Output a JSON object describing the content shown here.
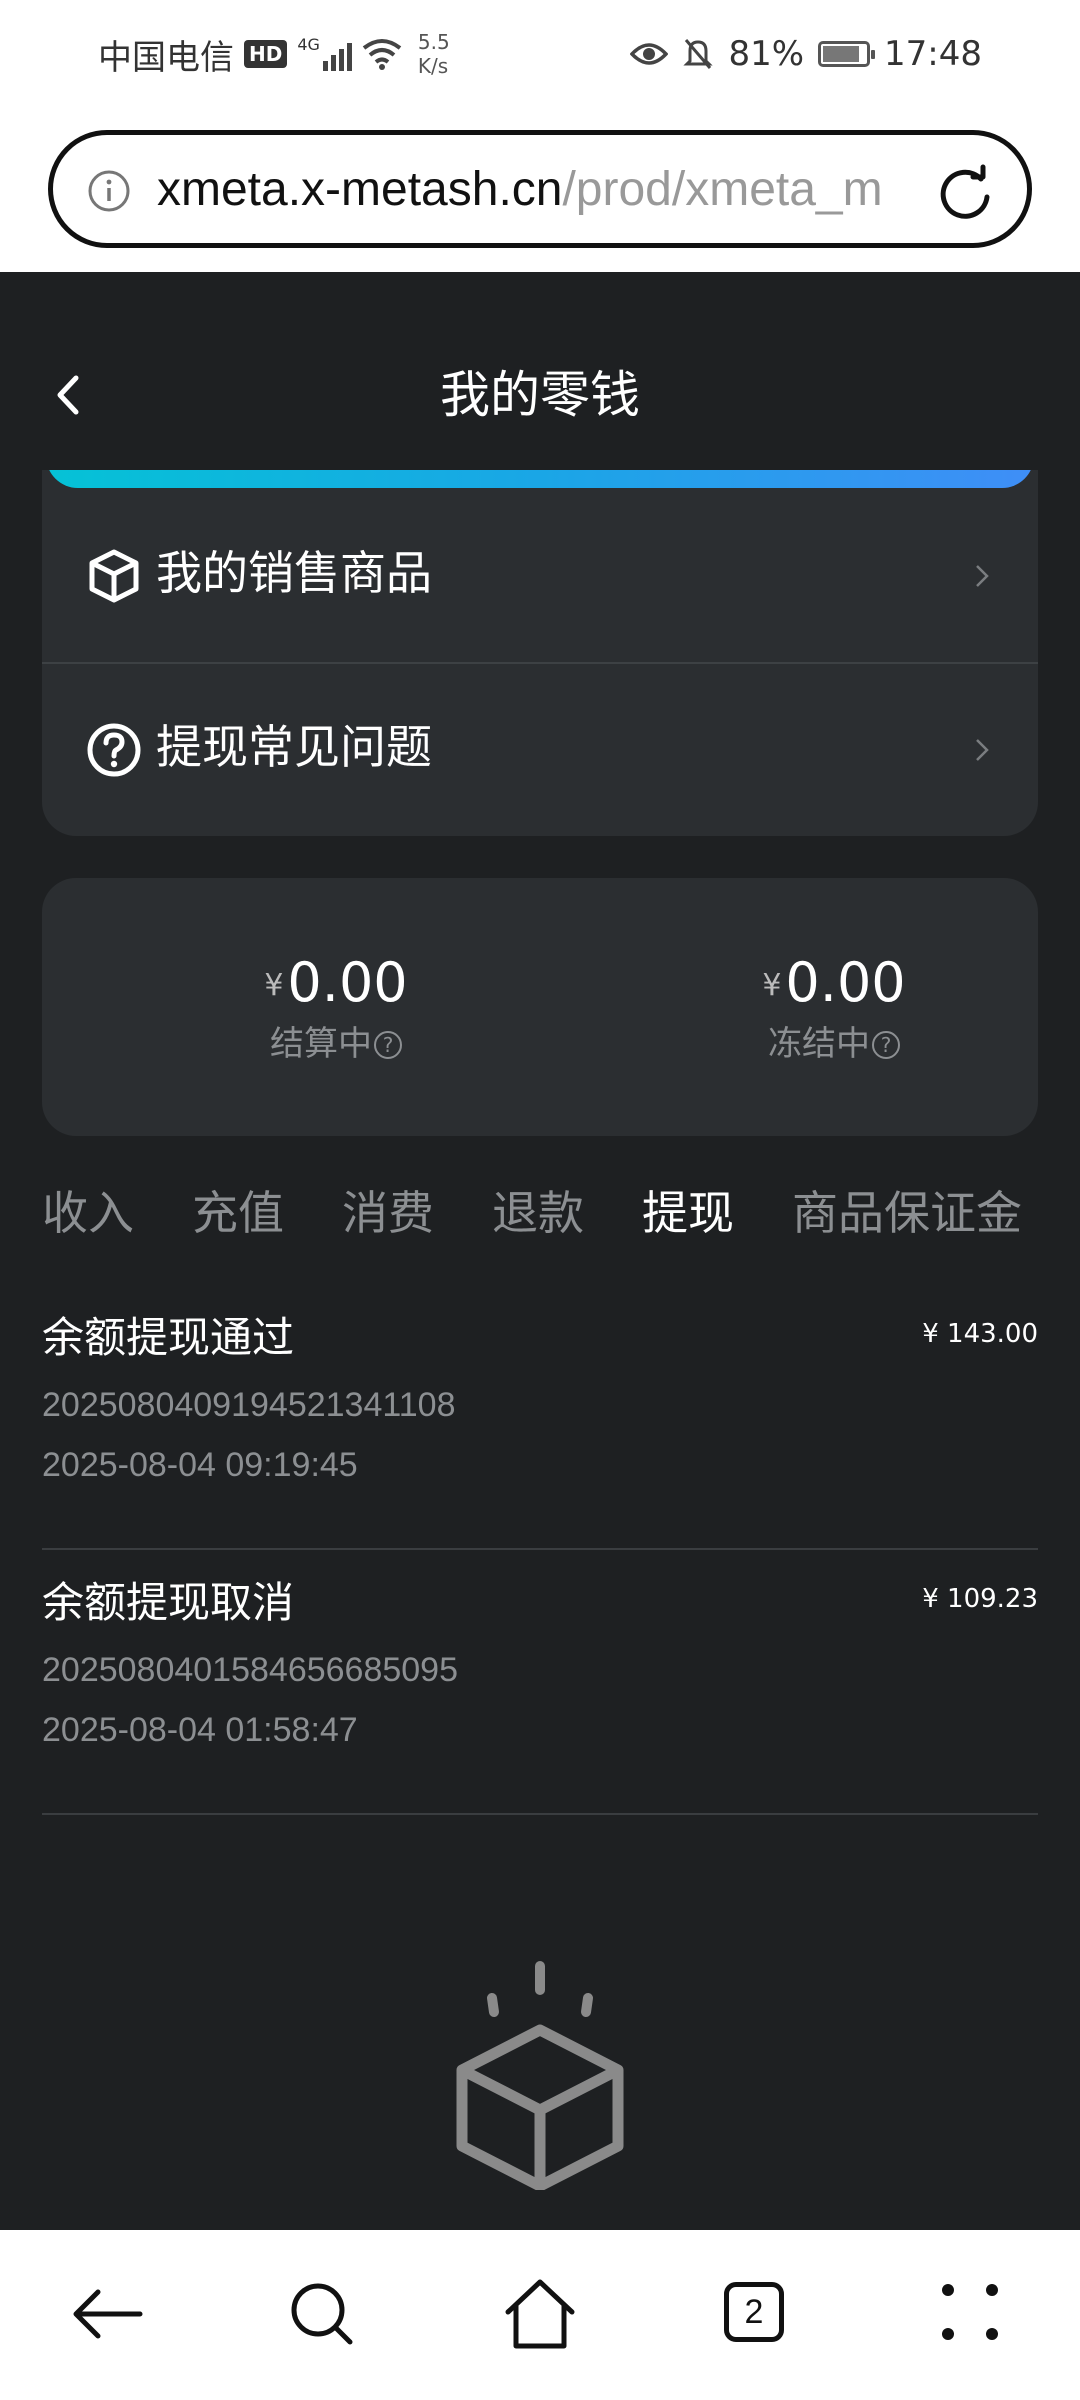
{
  "status_bar": {
    "carrier": "中国电信",
    "hd_badge": "HD",
    "signal": "4G",
    "net_speed_value": "5.5",
    "net_speed_unit": "K/s",
    "battery": "81%",
    "time": "17:48"
  },
  "url_bar": {
    "host": "xmeta.x-metash.cn",
    "path": "/prod/xmeta_m"
  },
  "header": {
    "title": "我的零钱"
  },
  "menu": {
    "items": [
      {
        "label": "我的销售商品",
        "icon": "cube-icon"
      },
      {
        "label": "提现常见问题",
        "icon": "question-circle-icon"
      }
    ]
  },
  "balances": {
    "currency_symbol": "¥",
    "settling": {
      "amount": "0.00",
      "label": "结算中"
    },
    "frozen": {
      "amount": "0.00",
      "label": "冻结中"
    },
    "help_glyph": "?"
  },
  "tabs": {
    "items": [
      "收入",
      "充值",
      "消费",
      "退款",
      "提现",
      "商品保证金"
    ],
    "active": "提现"
  },
  "records": [
    {
      "title": "余额提现通过",
      "amount": "¥ 143.00",
      "id": "20250804091945213411​08",
      "time": "2025-08-04 09:19:45"
    },
    {
      "title": "余额提现取消",
      "amount": "¥ 109.23",
      "id": "20250804015846566850​95",
      "time": "2025-08-04 01:58:47"
    }
  ],
  "bottom_nav": {
    "tab_count": "2"
  },
  "colors": {
    "background": "#1e2022",
    "card": "#2b2e31",
    "gradient_start": "#05c2d6",
    "gradient_end": "#3f8ef7",
    "muted_text": "#8c8f92"
  }
}
